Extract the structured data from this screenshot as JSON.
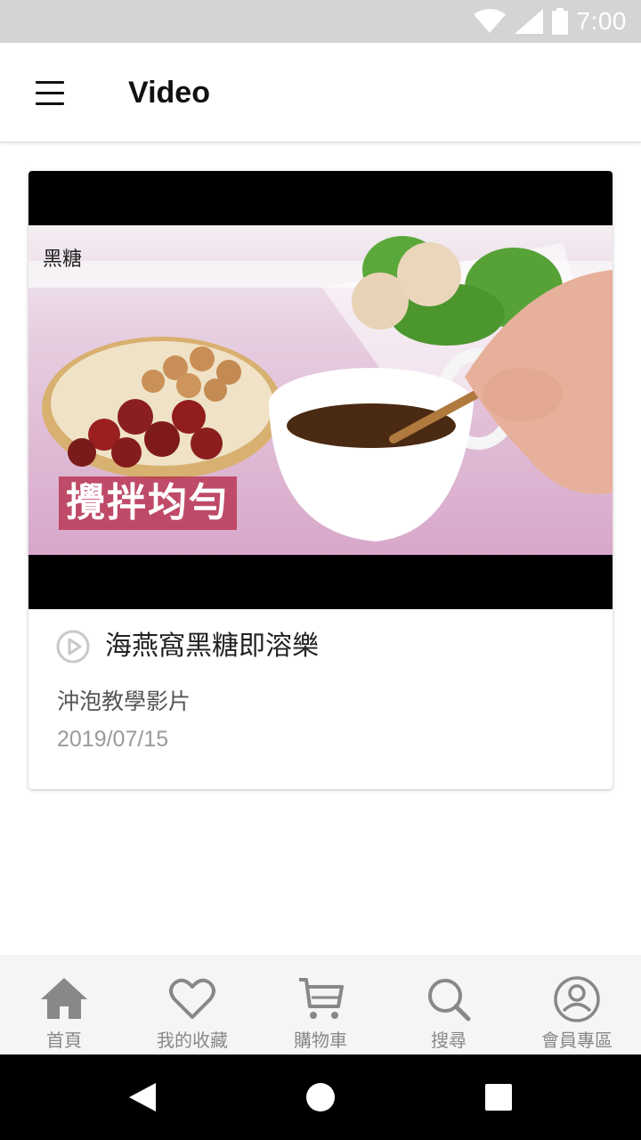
{
  "status_bar": {
    "time": "7:00",
    "icons": [
      "wifi-icon",
      "cell-signal-icon",
      "battery-icon"
    ]
  },
  "app_bar": {
    "title": "Video",
    "menu_icon": "hamburger-menu-icon"
  },
  "video": {
    "title": "海燕窩黑糖即溶樂",
    "subtitle": "沖泡教學影片",
    "date": "2019/07/15",
    "thumbnail_caption": "攪拌均勻",
    "thumbnail_logo": "黑糖",
    "play_icon": "play-circle-icon"
  },
  "bottom_nav": {
    "items": [
      {
        "label": "首頁",
        "icon": "home-icon"
      },
      {
        "label": "我的收藏",
        "icon": "heart-icon"
      },
      {
        "label": "購物車",
        "icon": "cart-icon"
      },
      {
        "label": "搜尋",
        "icon": "search-icon"
      },
      {
        "label": "會員專區",
        "icon": "user-circle-icon"
      }
    ]
  },
  "system_nav": {
    "icons": [
      "back-icon",
      "home-circle-icon",
      "recents-icon"
    ]
  },
  "colors": {
    "status_bar": "#d4d4d4",
    "nav_icon": "#888888",
    "thumbnail_bg": "#e3c3d8"
  }
}
